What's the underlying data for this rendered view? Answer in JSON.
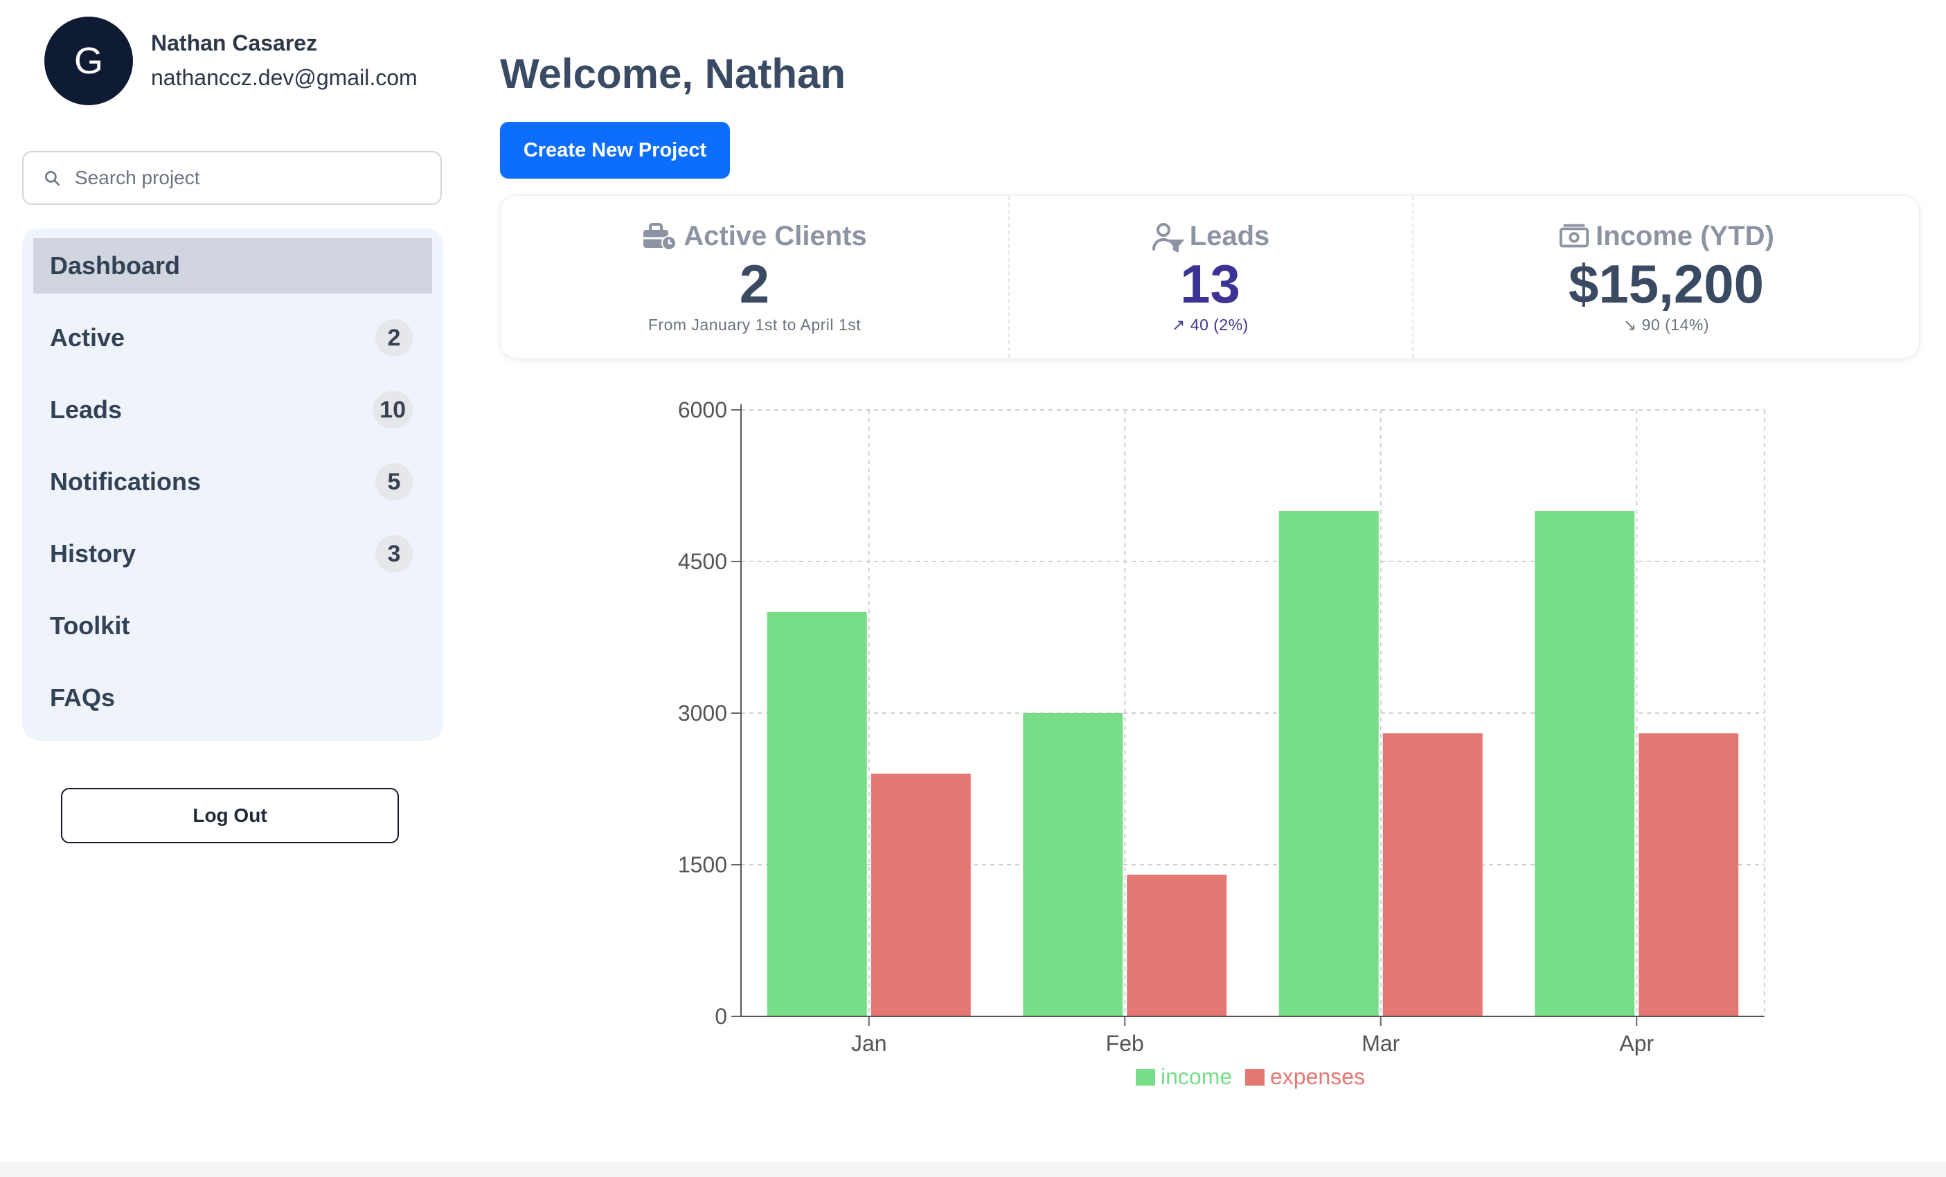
{
  "user": {
    "avatar_initial": "G",
    "name": "Nathan Casarez",
    "email": "nathanccz.dev@gmail.com"
  },
  "search": {
    "placeholder": "Search project",
    "icon": "search-icon"
  },
  "nav": {
    "items": [
      {
        "label": "Dashboard",
        "badge": null,
        "selected": true
      },
      {
        "label": "Active",
        "badge": "2"
      },
      {
        "label": "Leads",
        "badge": "10"
      },
      {
        "label": "Notifications",
        "badge": "5"
      },
      {
        "label": "History",
        "badge": "3"
      },
      {
        "label": "Toolkit",
        "badge": null
      },
      {
        "label": "FAQs",
        "badge": null
      }
    ]
  },
  "logout_label": "Log Out",
  "main": {
    "welcome": "Welcome, Nathan",
    "create_label": "Create New Project"
  },
  "stats": {
    "active_clients": {
      "title": "Active Clients",
      "value": "2",
      "desc": "From January 1st to April 1st",
      "icon": "briefcase-clock-icon"
    },
    "leads": {
      "title": "Leads",
      "value": "13",
      "desc": "↗ 40 (2%)",
      "icon": "user-filter-icon"
    },
    "income": {
      "title": "Income (YTD)",
      "value": "$15,200",
      "desc": "↘ 90 (14%)",
      "icon": "cash-icon"
    }
  },
  "colors": {
    "accent": "#0d6efd",
    "income": "#77dd88",
    "expenses": "#e57772",
    "avatar_bg": "#0f1b33"
  },
  "chart_data": {
    "type": "bar",
    "categories": [
      "Jan",
      "Feb",
      "Mar",
      "Apr"
    ],
    "series": [
      {
        "name": "income",
        "values": [
          4000,
          3000,
          5000,
          5000
        ],
        "color": "#77dd88"
      },
      {
        "name": "expenses",
        "values": [
          2400,
          1400,
          2800,
          2800
        ],
        "color": "#e57772"
      }
    ],
    "yticks": [
      "0",
      "1500",
      "3000",
      "4500",
      "6000"
    ],
    "ylim": [
      0,
      6000
    ],
    "grid": true,
    "legend": "bottom"
  }
}
